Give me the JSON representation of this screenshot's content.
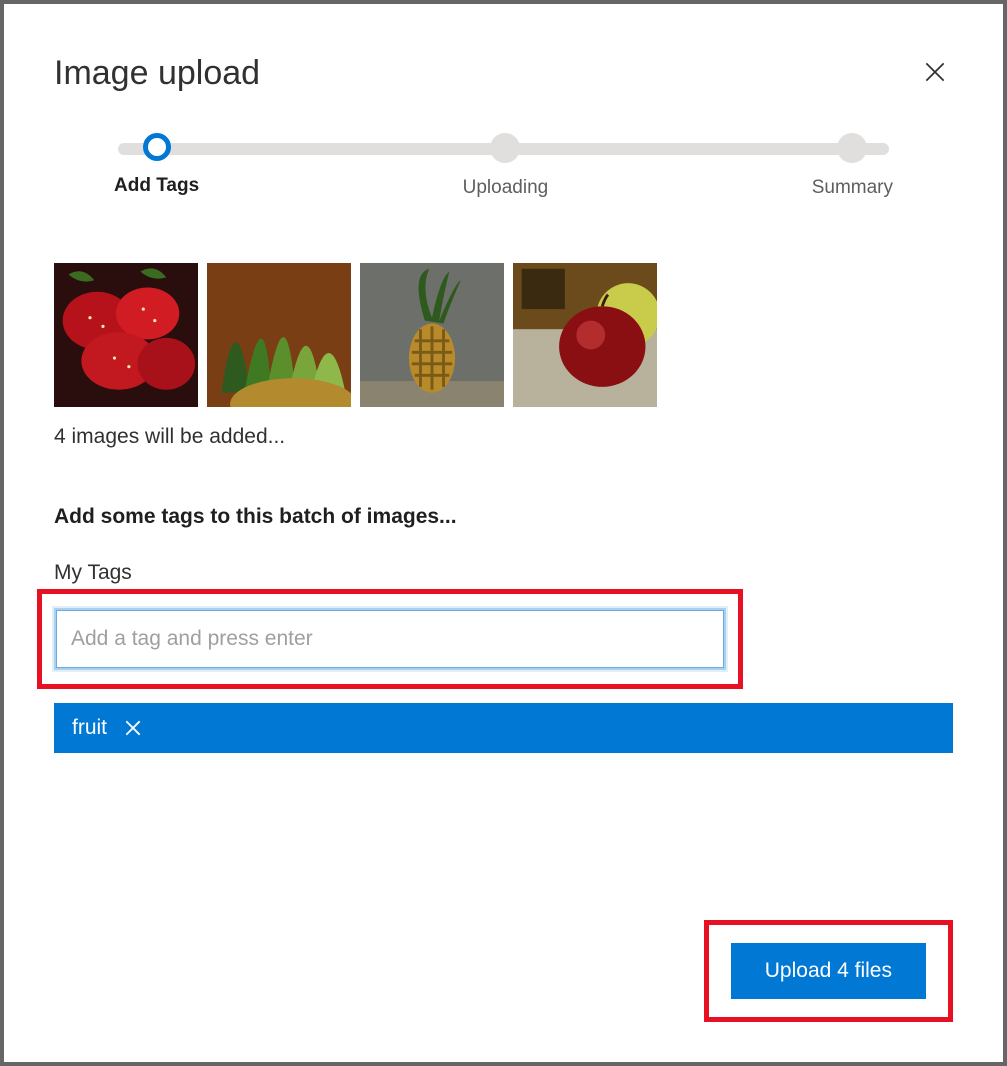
{
  "dialog": {
    "title": "Image upload"
  },
  "stepper": {
    "steps": [
      {
        "label": "Add Tags",
        "active": true
      },
      {
        "label": "Uploading",
        "active": false
      },
      {
        "label": "Summary",
        "active": false
      }
    ]
  },
  "thumbnails": {
    "count": 4,
    "items": [
      "strawberries",
      "pineapple-top",
      "pineapple",
      "apple"
    ]
  },
  "status_text": "4 images will be added...",
  "section_prompt": "Add some tags to this batch of images...",
  "tags": {
    "label": "My Tags",
    "input_placeholder": "Add a tag and press enter",
    "input_value": "",
    "chips": [
      "fruit"
    ]
  },
  "footer": {
    "upload_button": "Upload 4 files"
  },
  "colors": {
    "accent": "#0078d4",
    "highlight": "#e81123"
  }
}
